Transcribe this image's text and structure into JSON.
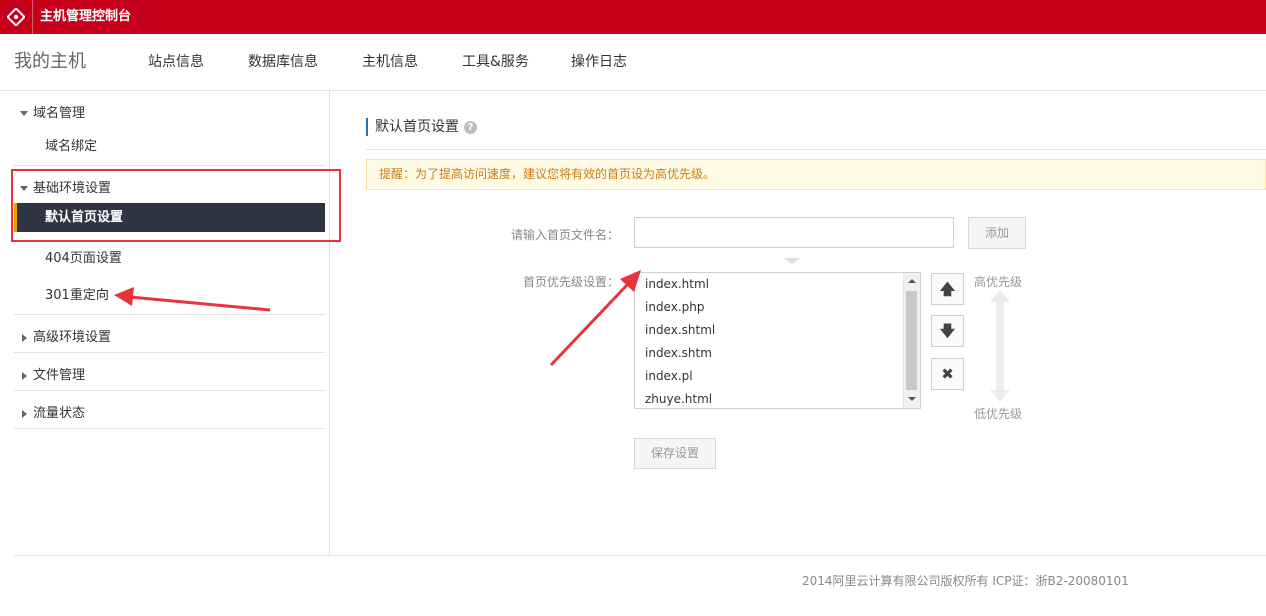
{
  "topbar": {
    "title": "主机管理控制台"
  },
  "navbar": {
    "brand": "我的主机",
    "items": [
      "站点信息",
      "数据库信息",
      "主机信息",
      "工具&服务",
      "操作日志"
    ]
  },
  "sidebar": {
    "domain_section": "域名管理",
    "domain_bind": "域名绑定",
    "basic_section": "基础环境设置",
    "default_page": "默认首页设置",
    "page_404": "404页面设置",
    "redirect_301": "301重定向",
    "advanced_section": "高级环境设置",
    "file_section": "文件管理",
    "traffic_section": "流量状态"
  },
  "main": {
    "title": "默认首页设置",
    "notice": "提醒：为了提高访问速度，建议您将有效的首页设为高优先级。",
    "input_label": "请输入首页文件名：",
    "input_value": "",
    "add_button": "添加",
    "priority_label": "首页优先级设置：",
    "priority_list": [
      "index.html",
      "index.php",
      "index.shtml",
      "index.shtm",
      "index.pl",
      "zhuye.html"
    ],
    "high_priority": "高优先级",
    "low_priority": "低优先级",
    "save_button": "保存设置"
  },
  "footer": {
    "copyright": "2014阿里云计算有限公司版权所有 ICP证：浙B2-20080101"
  },
  "colors": {
    "brand_red": "#c6001a",
    "active_bg": "#2f3542",
    "annotation_red": "#e8323c"
  }
}
